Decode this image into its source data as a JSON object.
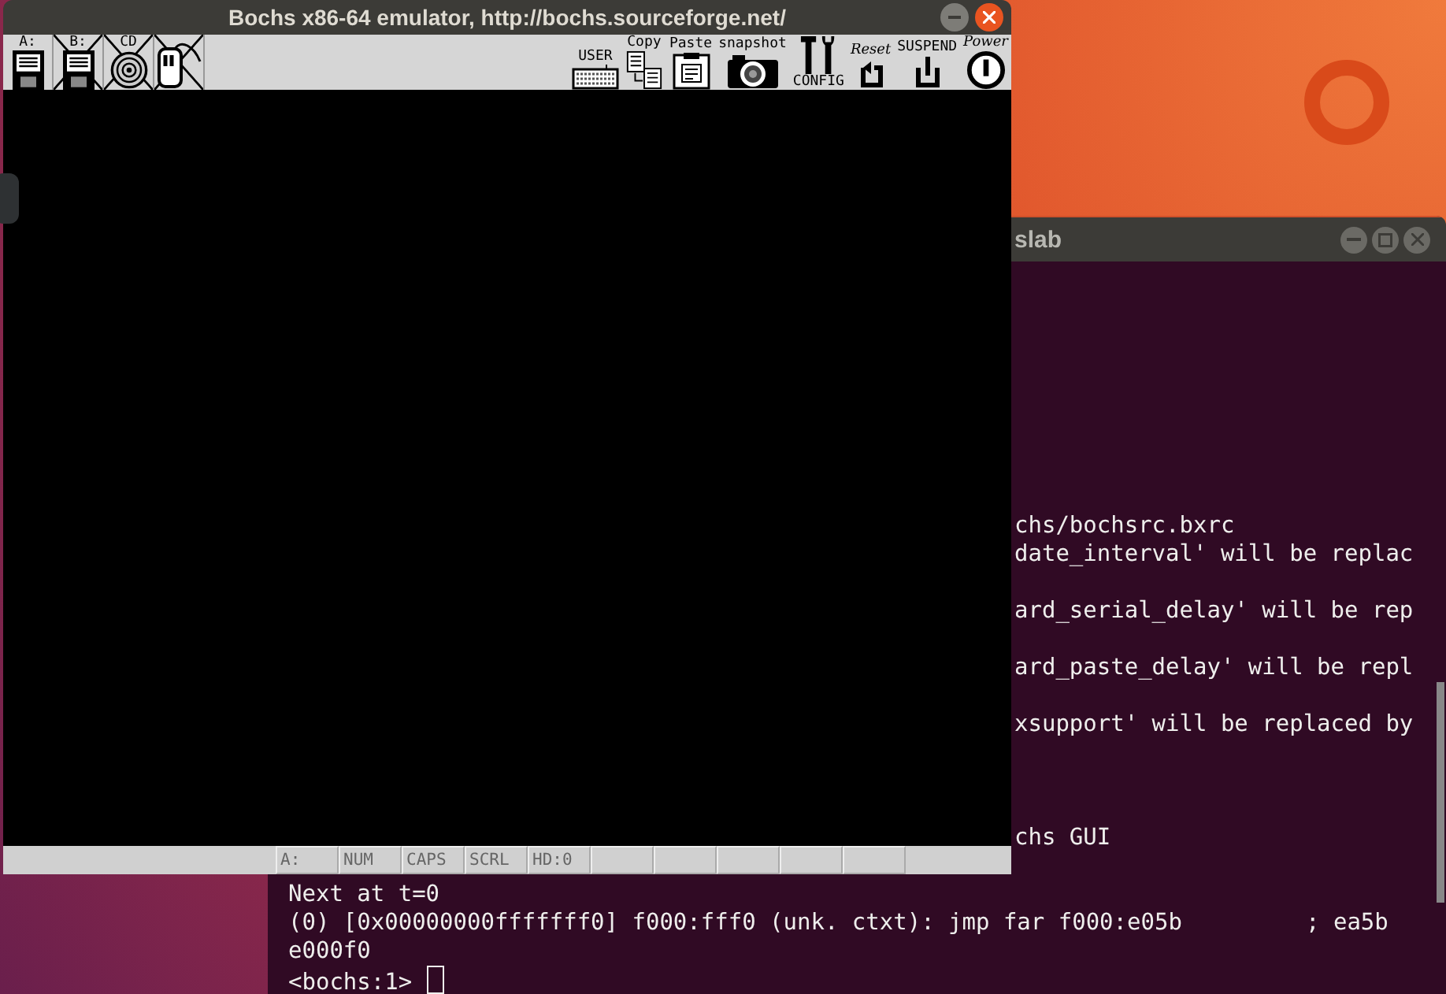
{
  "terminal": {
    "title": "slab",
    "lines": [
      {
        "kind": "partial",
        "text": "chs/bochsrc.bxrc"
      },
      {
        "kind": "partial",
        "text": "date_interval' will be replac"
      },
      {
        "kind": "blank"
      },
      {
        "kind": "partial",
        "text": "ard_serial_delay' will be rep"
      },
      {
        "kind": "blank"
      },
      {
        "kind": "partial",
        "text": "ard_paste_delay' will be repl"
      },
      {
        "kind": "blank"
      },
      {
        "kind": "partial",
        "text": "xsupport' will be replaced by"
      },
      {
        "kind": "blank"
      },
      {
        "kind": "blank"
      },
      {
        "kind": "blank"
      },
      {
        "kind": "partial",
        "text": "chs GUI"
      },
      {
        "kind": "blank"
      },
      {
        "kind": "full",
        "text": "Next at t=0"
      },
      {
        "kind": "full",
        "text": "(0) [0x00000000fffffff0] f000:fff0 (unk. ctxt): jmp far f000:e05b         ; ea5b"
      },
      {
        "kind": "full",
        "text": "e000f0"
      }
    ],
    "prompt": "<bochs:1>"
  },
  "bochs": {
    "title": "Bochs x86-64 emulator, http://bochs.sourceforge.net/",
    "toolbar_left": [
      {
        "label": "A:",
        "kind": "floppy",
        "crossed": false
      },
      {
        "label": "B:",
        "kind": "floppy",
        "crossed": true
      },
      {
        "label": "CD",
        "kind": "cdrom",
        "crossed": true
      },
      {
        "kind": "mouse",
        "crossed": true
      }
    ],
    "toolbar_right": [
      {
        "label": "USER",
        "kind": "keyboard"
      },
      {
        "label": "Copy",
        "kind": "copy"
      },
      {
        "label": "Paste",
        "kind": "paste"
      },
      {
        "label": "snapshot",
        "kind": "camera"
      },
      {
        "label": "CONFIG",
        "kind": "config"
      },
      {
        "label": "Reset",
        "kind": "reset"
      },
      {
        "label": "SUSPEND",
        "kind": "suspend"
      },
      {
        "label": "Power",
        "kind": "power"
      }
    ],
    "status_bar": [
      "A:",
      "NUM",
      "CAPS",
      "SCRL",
      "HD:0"
    ]
  }
}
